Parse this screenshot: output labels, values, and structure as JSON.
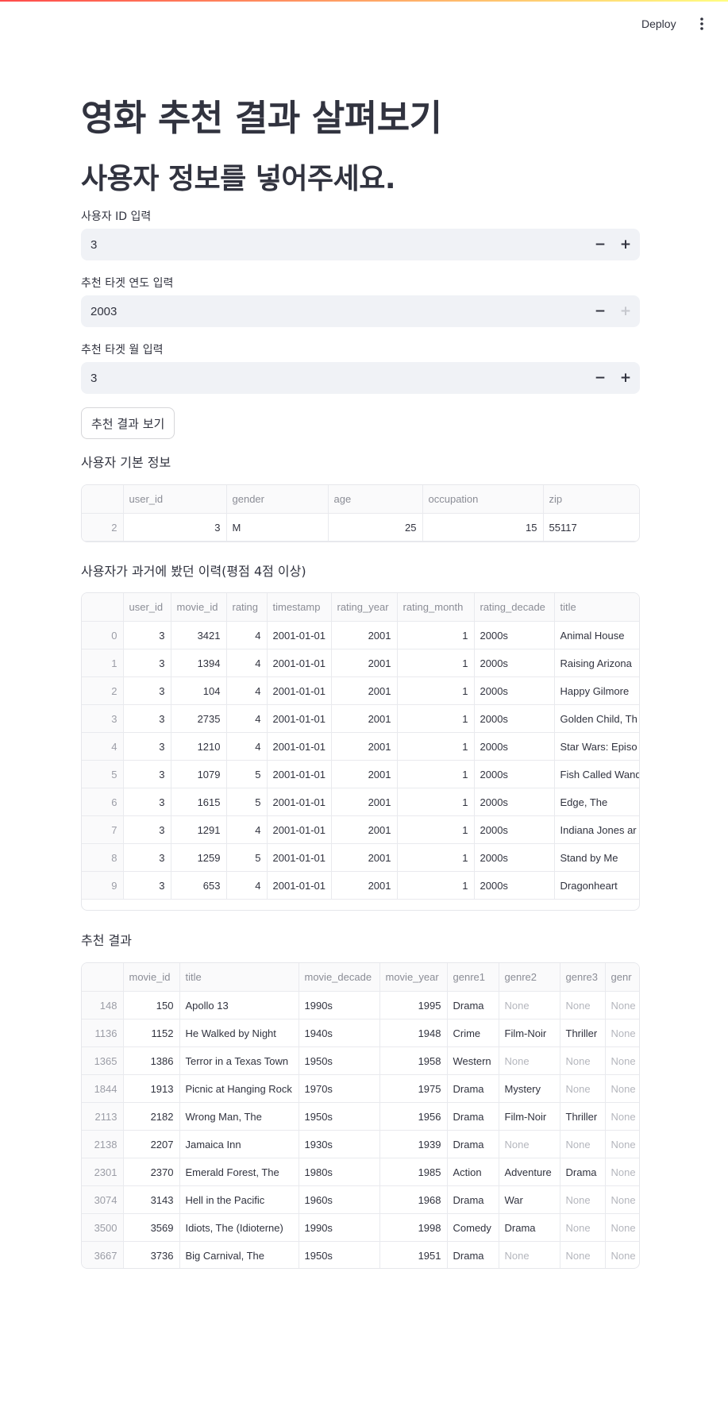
{
  "header": {
    "deploy_label": "Deploy",
    "menu_icon": "more-vertical-icon"
  },
  "page": {
    "title": "영화 추천 결과 살펴보기",
    "subtitle": "사용자 정보를 넣어주세요."
  },
  "inputs": {
    "user_id": {
      "label": "사용자 ID 입력",
      "value": "3"
    },
    "year": {
      "label": "추천 타겟 연도 입력",
      "value": "2003",
      "plus_disabled": true
    },
    "month": {
      "label": "추천 타겟 월 입력",
      "value": "3"
    }
  },
  "button": {
    "label": "추천 결과 보기"
  },
  "user_info": {
    "label": "사용자 기본 정보",
    "columns": [
      "",
      "user_id",
      "gender",
      "age",
      "occupation",
      "zip"
    ],
    "rows": [
      [
        "2",
        "3",
        "M",
        "25",
        "15",
        "55117"
      ]
    ]
  },
  "history": {
    "label": "사용자가 과거에 봤던 이력(평점 4점 이상)",
    "columns": [
      "",
      "user_id",
      "movie_id",
      "rating",
      "timestamp",
      "rating_year",
      "rating_month",
      "rating_decade",
      "title"
    ],
    "rows": [
      [
        "0",
        "3",
        "3421",
        "4",
        "2001-01-01",
        "2001",
        "1",
        "2000s",
        "Animal House"
      ],
      [
        "1",
        "3",
        "1394",
        "4",
        "2001-01-01",
        "2001",
        "1",
        "2000s",
        "Raising Arizona"
      ],
      [
        "2",
        "3",
        "104",
        "4",
        "2001-01-01",
        "2001",
        "1",
        "2000s",
        "Happy Gilmore"
      ],
      [
        "3",
        "3",
        "2735",
        "4",
        "2001-01-01",
        "2001",
        "1",
        "2000s",
        "Golden Child, Th"
      ],
      [
        "4",
        "3",
        "1210",
        "4",
        "2001-01-01",
        "2001",
        "1",
        "2000s",
        "Star Wars: Episo"
      ],
      [
        "5",
        "3",
        "1079",
        "5",
        "2001-01-01",
        "2001",
        "1",
        "2000s",
        "Fish Called Wand"
      ],
      [
        "6",
        "3",
        "1615",
        "5",
        "2001-01-01",
        "2001",
        "1",
        "2000s",
        "Edge, The"
      ],
      [
        "7",
        "3",
        "1291",
        "4",
        "2001-01-01",
        "2001",
        "1",
        "2000s",
        "Indiana Jones ar"
      ],
      [
        "8",
        "3",
        "1259",
        "5",
        "2001-01-01",
        "2001",
        "1",
        "2000s",
        "Stand by Me"
      ],
      [
        "9",
        "3",
        "653",
        "4",
        "2001-01-01",
        "2001",
        "1",
        "2000s",
        "Dragonheart"
      ]
    ]
  },
  "recommend": {
    "label": "추천 결과",
    "columns": [
      "",
      "movie_id",
      "title",
      "movie_decade",
      "movie_year",
      "genre1",
      "genre2",
      "genre3",
      "genr"
    ],
    "rows": [
      [
        "148",
        "150",
        "Apollo 13",
        "1990s",
        "1995",
        "Drama",
        "None",
        "None",
        "None"
      ],
      [
        "1136",
        "1152",
        "He Walked by Night",
        "1940s",
        "1948",
        "Crime",
        "Film-Noir",
        "Thriller",
        "None"
      ],
      [
        "1365",
        "1386",
        "Terror in a Texas Town",
        "1950s",
        "1958",
        "Western",
        "None",
        "None",
        "None"
      ],
      [
        "1844",
        "1913",
        "Picnic at Hanging Rock",
        "1970s",
        "1975",
        "Drama",
        "Mystery",
        "None",
        "None"
      ],
      [
        "2113",
        "2182",
        "Wrong Man, The",
        "1950s",
        "1956",
        "Drama",
        "Film-Noir",
        "Thriller",
        "None"
      ],
      [
        "2138",
        "2207",
        "Jamaica Inn",
        "1930s",
        "1939",
        "Drama",
        "None",
        "None",
        "None"
      ],
      [
        "2301",
        "2370",
        "Emerald Forest, The",
        "1980s",
        "1985",
        "Action",
        "Adventure",
        "Drama",
        "None"
      ],
      [
        "3074",
        "3143",
        "Hell in the Pacific",
        "1960s",
        "1968",
        "Drama",
        "War",
        "None",
        "None"
      ],
      [
        "3500",
        "3569",
        "Idiots, The (Idioterne)",
        "1990s",
        "1998",
        "Comedy",
        "Drama",
        "None",
        "None"
      ],
      [
        "3667",
        "3736",
        "Big Carnival, The",
        "1950s",
        "1951",
        "Drama",
        "None",
        "None",
        "None"
      ]
    ]
  }
}
